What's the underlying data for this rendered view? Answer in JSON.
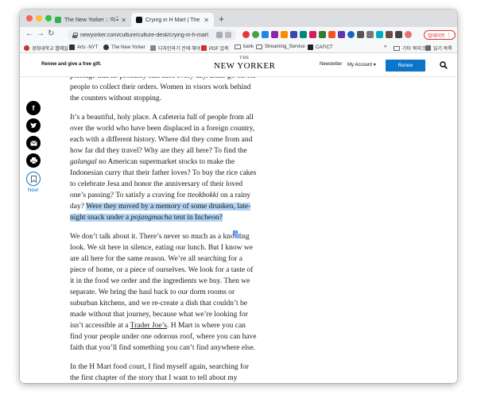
{
  "browser": {
    "tabs": [
      {
        "title": "The New Yorker :: 미국의 한인이",
        "active": false,
        "favicon_color": "#2bb24c"
      },
      {
        "title": "Crying in H Mart | The New Yo",
        "active": true,
        "favicon_color": "#111111"
      }
    ],
    "url": "newyorker.com/culture/culture-desk/crying-in-h-mart",
    "update_label": "업데이트",
    "bookmarks": [
      {
        "label": "경희대학교 웹메일",
        "icon_color": "#c0392b"
      },
      {
        "label": "Arts -NYT",
        "icon_color": "#333333"
      },
      {
        "label": "The New Yorker",
        "icon_color": "#333333"
      },
      {
        "label": "디자인마기 전에 해야...",
        "icon_color": "#888888"
      },
      {
        "label": "PDF 압축",
        "icon_color": "#d32f2f"
      },
      {
        "label": "bank",
        "icon": "folder-icon"
      },
      {
        "label": "Streaming_Service",
        "icon": "folder-icon"
      },
      {
        "label": "CAFICT",
        "icon_color": "#222222"
      },
      {
        "label": "기타 북마크",
        "icon": "folder-icon"
      },
      {
        "label": "읽기 목록",
        "icon": "reading-list-icon"
      }
    ]
  },
  "site": {
    "promo": "Renew and give a free gift.",
    "logo_top": "THE",
    "logo_name": "NEW YORKER",
    "newsletter": "Newsletter",
    "my_account": "My Account",
    "renew": "Renew",
    "accent_color": "#0b75c9"
  },
  "sidebar": {
    "new_label": "New!",
    "share_icons": [
      "facebook-icon",
      "twitter-icon",
      "email-icon",
      "print-icon"
    ]
  },
  "article": {
    "p1": "porridge that he probably eats here every day. Bells go off for people to collect their orders. Women in visors work behind the counters without stopping.",
    "p2_a": "It’s a beautiful, holy place. A cafeteria full of people from all over the world who have been displaced in a foreign country, each with a different history. Where did they come from and how far did they travel? Why are they all here? To find the ",
    "p2_galangal": "galangal",
    "p2_b": " no American supermarket stocks to make the Indonesian curry that their father loves? To buy the rice cakes to celebrate Jesa and honor the anniversary of their loved one’s passing? To satisfy a craving for ",
    "p2_tteokbokki": "tteokbokki",
    "p2_c": " on a rainy day? ",
    "p2_hl_a": "Were they moved by a memory of some drunken, late-night snack under a ",
    "p2_hl_pojangmacha": "pojangmacha",
    "p2_hl_b": " tent in Incheon?",
    "p3_a": "We don’t talk about it. There’s never so much as a knowing look. We sit here in silence, eating our lunch. But I know we are all here for the same reason. We’re all searching for a piece of home, or a piece of ourselves. We look for a taste of it in the food we order and the ingredients we buy. Then we separate. We bring the haul back to our dorm rooms or suburban kitchens, and we re-create a dish that couldn’t be made without that journey, because what we’re looking for isn’t accessible at a ",
    "p3_link": "Trader Joe’s",
    "p3_b": ". H Mart is where you can find your people under one odorous roof, where you can have faith that you’ll find something you can’t find anywhere else.",
    "p4": "In the H Mart food court, I find myself again, searching for the first chapter of the story that I want to tell about my mother. I"
  }
}
